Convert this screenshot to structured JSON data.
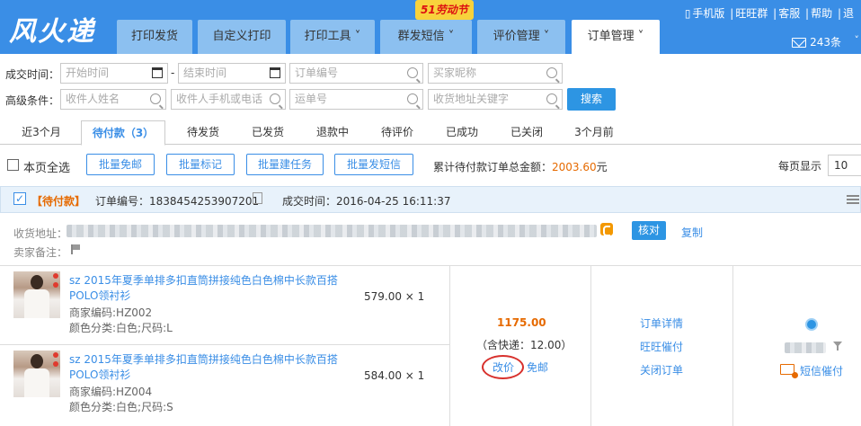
{
  "brand": {
    "logo": "风火递",
    "promo_badge": "51劳动节"
  },
  "nav": {
    "tabs": [
      {
        "label": "打印发货"
      },
      {
        "label": "自定义打印"
      },
      {
        "label": "打印工具 ˅"
      },
      {
        "label": "群发短信 ˅"
      },
      {
        "label": "评价管理 ˅"
      },
      {
        "label": "订单管理 ˅"
      }
    ],
    "top_links": [
      "手机版",
      "旺旺群",
      "客服",
      "帮助",
      "退"
    ],
    "message_count": "243条",
    "more": "˅"
  },
  "filters": {
    "deal_time_label": "成交时间：",
    "start_placeholder": "开始时间",
    "dash": "-",
    "end_placeholder": "结束时间",
    "order_no_placeholder": "订单编号",
    "buyer_nick_placeholder": "买家昵称",
    "advanced_label": "高级条件：",
    "receiver_name_placeholder": "收件人姓名",
    "receiver_phone_placeholder": "收件人手机或电话",
    "waybill_placeholder": "运单号",
    "address_keyword_placeholder": "收货地址关键字",
    "search_button": "搜索"
  },
  "status_tabs": [
    {
      "label": "近3个月"
    },
    {
      "label": "待付款（3）"
    },
    {
      "label": "待发货"
    },
    {
      "label": "已发货"
    },
    {
      "label": "退款中"
    },
    {
      "label": "待评价"
    },
    {
      "label": "已成功"
    },
    {
      "label": "已关闭"
    },
    {
      "label": "3个月前"
    }
  ],
  "batch": {
    "select_all": "本页全选",
    "buttons": [
      "批量免邮",
      "批量标记",
      "批量建任务",
      "批量发短信"
    ],
    "total_label": "累计待付款订单总金额：",
    "total_value": "2003.60",
    "total_unit": "元",
    "per_page_label": "每页显示",
    "per_page_value": "10"
  },
  "order": {
    "status": "【待付款】",
    "order_no_label": "订单编号：",
    "order_no": "1838454253907201",
    "deal_time_label": "成交时间：",
    "deal_time": "2016-04-25 16:11:37",
    "address_label": "收货地址：",
    "verify_button": "核对",
    "copy_link": "复制",
    "seller_note_label": "卖家备注：",
    "items": [
      {
        "title": "sz 2015年夏季单排多扣直筒拼接纯色白色棉中长款百搭POLO领衬衫",
        "merchant_code": "商家编码:HZ002",
        "sku": "颜色分类:白色;尺码:L",
        "price_qty": "579.00 × 1"
      },
      {
        "title": "sz 2015年夏季单排多扣直筒拼接纯色白色棉中长款百搭POLO领衬衫",
        "merchant_code": "商家编码:HZ004",
        "sku": "颜色分类:白色;尺码:S",
        "price_qty": "584.00 × 1"
      }
    ],
    "amount": "1175.00",
    "shipping": "（含快递：12.00）",
    "change_price": "改价",
    "free_shipping": "免邮",
    "ops": [
      "订单详情",
      "旺旺催付",
      "关闭订单"
    ],
    "sms_remind": "短信催付"
  },
  "colors": {
    "brand_blue": "#3a8ee6",
    "accent_orange": "#e66a00",
    "highlight_red": "#d8312d"
  }
}
